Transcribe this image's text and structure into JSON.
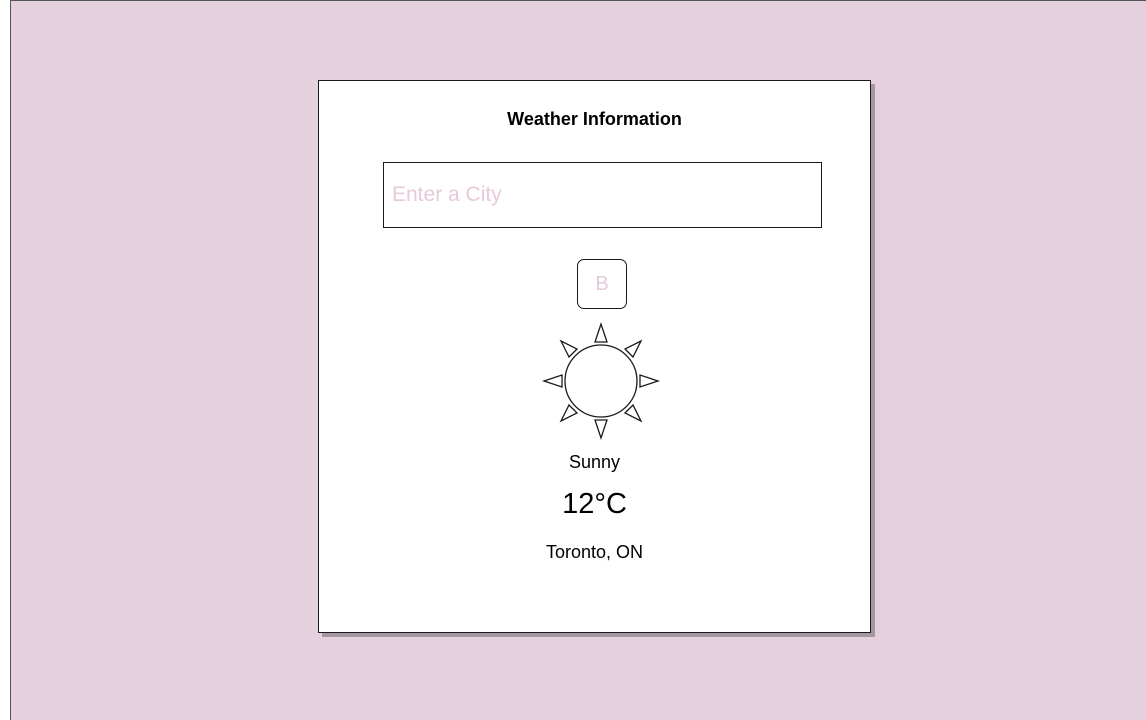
{
  "app": {
    "title": "Weather Information"
  },
  "search": {
    "placeholder": "Enter a City",
    "value": ""
  },
  "button": {
    "label": "B"
  },
  "weather": {
    "icon": "sun-icon",
    "condition": "Sunny",
    "temperature": "12°C",
    "location": "Toronto, ON"
  },
  "colors": {
    "background": "#e5d1dd",
    "card": "#ffffff",
    "placeholder": "#e8c9dc",
    "border": "#1a1a1a"
  }
}
